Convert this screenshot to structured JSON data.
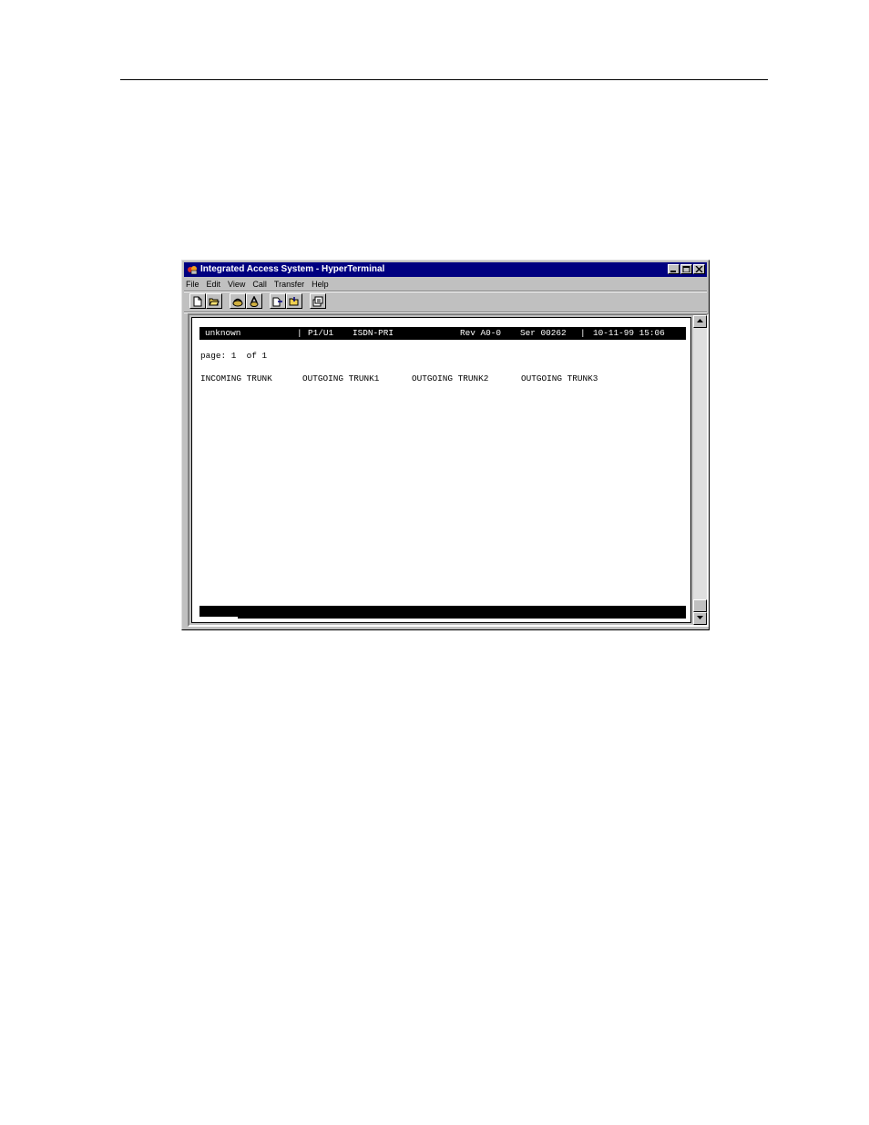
{
  "window": {
    "title": "Integrated Access System - HyperTerminal",
    "menu": [
      "File",
      "Edit",
      "View",
      "Call",
      "Transfer",
      "Help"
    ],
    "toolbar_icons": [
      "new-icon",
      "open-icon",
      "connect-icon",
      "disconnect-icon",
      "send-icon",
      "receive-icon",
      "properties-icon"
    ]
  },
  "terminal": {
    "status": {
      "name": "unknown",
      "sep1": "|",
      "slot": "P1/U1",
      "card": "ISDN-PRI",
      "rev": "Rev A0-0",
      "ser": "Ser 00262",
      "sep2": "|",
      "datetime": "10-11-99 15:06"
    },
    "page_label": "page: 1  of 1",
    "columns": [
      "INCOMING TRUNK",
      "OUTGOING TRUNK1",
      "OUTGOING TRUNK2",
      "OUTGOING TRUNK3"
    ]
  }
}
